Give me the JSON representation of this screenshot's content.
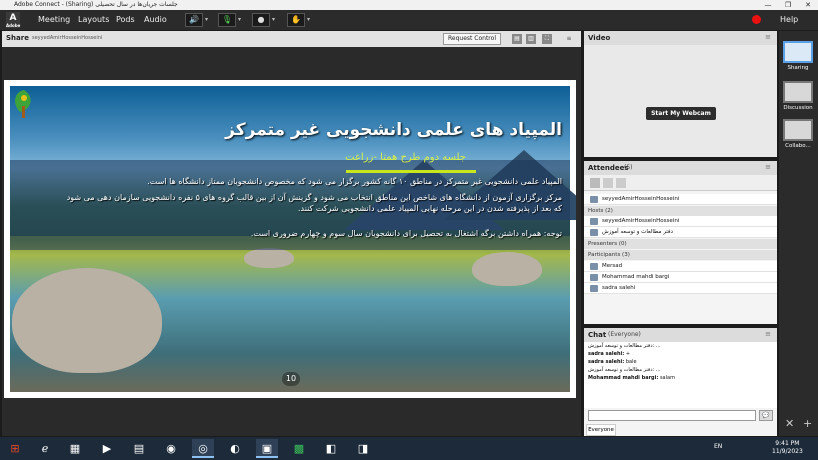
{
  "window": {
    "title": "Adobe Connect - (Sharing) جلسات جریان‌ها در سال تحصیلی",
    "minimize": "—",
    "maximize": "❐",
    "close": "✕"
  },
  "menubar": {
    "logo_letter": "A",
    "logo_sub": "Adobe",
    "items": [
      "Meeting",
      "Layouts",
      "Pods",
      "Audio"
    ],
    "help": "Help"
  },
  "share": {
    "label": "Share",
    "presenter": "seyyedAmirHosseinHosseini",
    "request_control": "Request Control",
    "slide": {
      "title": "المپیاد های علمی دانشجویی غیر متمرکز",
      "subtitle": "جلسه دوم طرح همتا -زراعت",
      "paragraphs": [
        "المپیاد علمی دانشجویی غیر متمرکز در مناطق ۱۰ گانه کشور برگزار می شود که مخصوص دانشجویان ممتاز دانشگاه ها است.",
        "مرکز برگزاری آزمون از دانشگاه های شاخص این مناطق انتخاب می شود و گزینش آن از بین قالب گروه های ۵ نفره دانشجویی سازمان دهی می شود که بعد از پذیرفته شدن در این مرحله نهایی المپیاد علمی دانشجویی شرکت کنند.",
        "توجه: همراه داشتن برگه اشتغال به تحصیل برای دانشجویان سال سوم و چهارم ضروری است."
      ],
      "page_number": "10"
    }
  },
  "video": {
    "label": "Video",
    "start_webcam": "Start My Webcam"
  },
  "attendees": {
    "label": "Attendees",
    "count": "(5)",
    "active_speaker": "seyyedAmirHosseinHosseini",
    "hosts_label": "Hosts (2)",
    "hosts": [
      "seyyedAmirHosseinHosseini",
      "دفتر مطالعات و توسعه آموزش"
    ],
    "presenters_label": "Presenters (0)",
    "participants_label": "Participants (3)",
    "participants": [
      "Mersad",
      "Mohammad mahdi bargi",
      "sadra salehi"
    ]
  },
  "chat": {
    "label": "Chat",
    "scope": "(Everyone)",
    "messages": [
      {
        "who": "",
        "text": "دفتر مطالعات و توسعه آموزش: ..."
      },
      {
        "who": "sadra salehi:",
        "text": "+"
      },
      {
        "who": "sadra salehi:",
        "text": "bale"
      },
      {
        "who": "",
        "text": "دفتر مطالعات و توسعه آموزش: ..."
      },
      {
        "who": "Mohammad mahdi bargi:",
        "text": "salam"
      }
    ],
    "tab": "Everyone",
    "send_icon": "💬"
  },
  "layouts": [
    "Sharing",
    "Discussion",
    "Collabo..."
  ],
  "taskbar": {
    "lang": "EN",
    "time": "9:41 PM",
    "date": "11/9/2023"
  }
}
